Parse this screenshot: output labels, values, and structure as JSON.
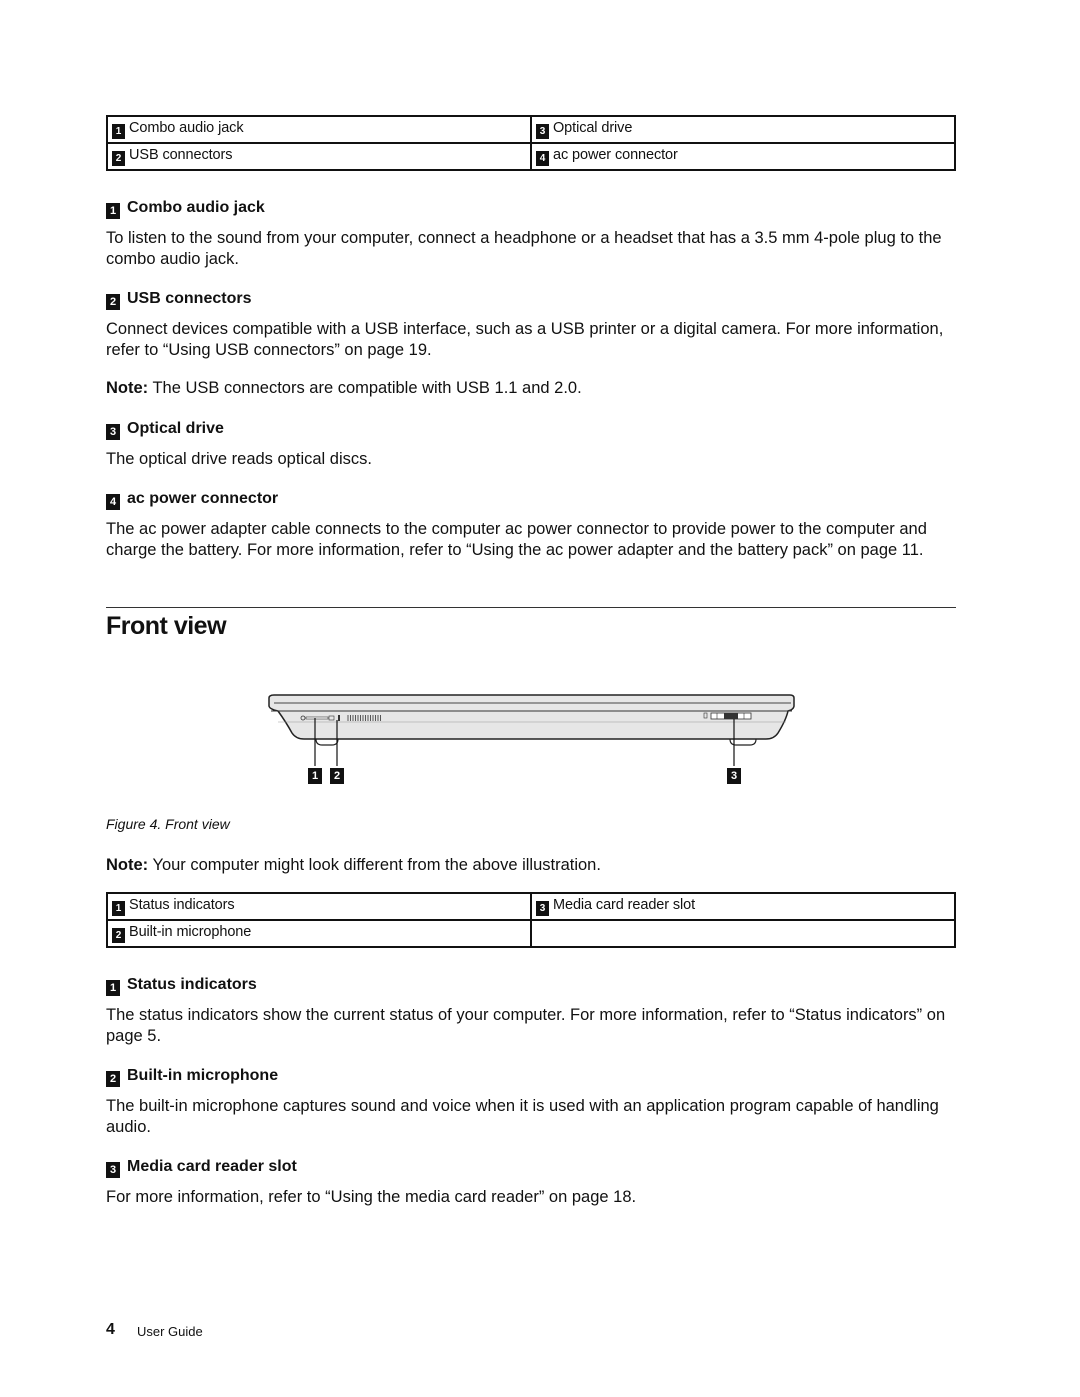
{
  "table1": {
    "rows": [
      [
        {
          "num": "1",
          "label": "Combo audio jack"
        },
        {
          "num": "3",
          "label": "Optical drive"
        }
      ],
      [
        {
          "num": "2",
          "label": "USB connectors"
        },
        {
          "num": "4",
          "label": "ac power connector"
        }
      ]
    ]
  },
  "sections1": [
    {
      "num": "1",
      "title": "Combo audio jack",
      "body": "To listen to the sound from your computer, connect a headphone or a headset that has a 3.5 mm 4-pole plug to the combo audio jack."
    },
    {
      "num": "2",
      "title": "USB connectors",
      "body": "Connect devices compatible with a USB interface, such as a USB printer or a digital camera. For more information, refer to “Using USB connectors” on page 19.",
      "note_label": "Note:",
      "note": " The USB connectors are compatible with USB 1.1 and 2.0."
    },
    {
      "num": "3",
      "title": "Optical drive",
      "body": "The optical drive reads optical discs."
    },
    {
      "num": "4",
      "title": "ac power connector",
      "body": "The ac power adapter cable connects to the computer ac power connector to provide power to the computer and charge the battery. For more information, refer to “Using the ac power adapter and the battery pack” on page 11."
    }
  ],
  "front_view": {
    "heading": "Front view",
    "figure_callouts": [
      "1",
      "2",
      "3"
    ],
    "caption": "Figure 4.  Front view",
    "note_label": "Note:",
    "note": " Your computer might look different from the above illustration."
  },
  "table2": {
    "rows": [
      [
        {
          "num": "1",
          "label": "Status indicators"
        },
        {
          "num": "3",
          "label": "Media card reader slot"
        }
      ],
      [
        {
          "num": "2",
          "label": "Built-in microphone"
        },
        {
          "num": "",
          "label": ""
        }
      ]
    ]
  },
  "sections2": [
    {
      "num": "1",
      "title": "Status indicators",
      "body": "The status indicators show the current status of your computer. For more information, refer to “Status indicators” on page 5."
    },
    {
      "num": "2",
      "title": "Built-in microphone",
      "body": "The built-in microphone captures sound and voice when it is used with an application program capable of handling audio."
    },
    {
      "num": "3",
      "title": "Media card reader slot",
      "body": "For more information, refer to “Using the media card reader” on page 18."
    }
  ],
  "footer": {
    "page_number": "4",
    "label": "User Guide"
  }
}
